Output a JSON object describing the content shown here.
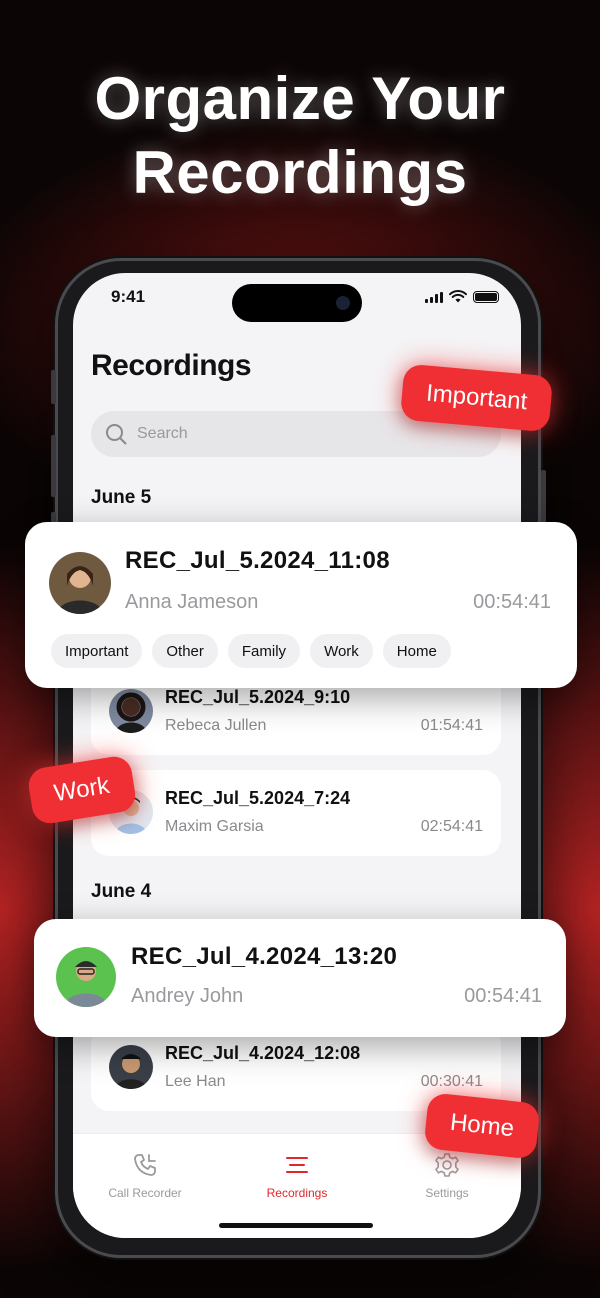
{
  "headline": {
    "line1": "Organize Your",
    "line2": "Recordings"
  },
  "status_bar": {
    "time": "9:41"
  },
  "screen": {
    "title": "Recordings",
    "search": {
      "placeholder": "Search"
    }
  },
  "sections": [
    "June 5",
    "June 4"
  ],
  "featured_card": {
    "name": "REC_Jul_5.2024_11:08",
    "person": "Anna Jameson",
    "duration": "00:54:41",
    "tags": [
      "Important",
      "Other",
      "Family",
      "Work",
      "Home"
    ]
  },
  "rows": [
    {
      "name": "REC_Jul_5.2024_9:10",
      "person": "Rebeca Jullen",
      "duration": "01:54:41"
    },
    {
      "name": "REC_Jul_5.2024_7:24",
      "person": "Maxim Garsia",
      "duration": "02:54:41"
    },
    {
      "name": "REC_Jul_4.2024_12:08",
      "person": "Lee Han",
      "duration": "00:30:41"
    }
  ],
  "second_card": {
    "name": "REC_Jul_4.2024_13:20",
    "person": "Andrey John",
    "duration": "00:54:41"
  },
  "floating_tags": {
    "important": "Important",
    "work": "Work",
    "home": "Home"
  },
  "tabbar": {
    "tabs": [
      {
        "label": "Call Recorder",
        "icon": "phone-icon"
      },
      {
        "label": "Recordings",
        "icon": "list-icon",
        "active": true
      },
      {
        "label": "Settings",
        "icon": "gear-icon"
      }
    ]
  },
  "colors": {
    "accent": "#ef2f33",
    "background": "#0b0505",
    "screen": "#f4f4f6"
  }
}
